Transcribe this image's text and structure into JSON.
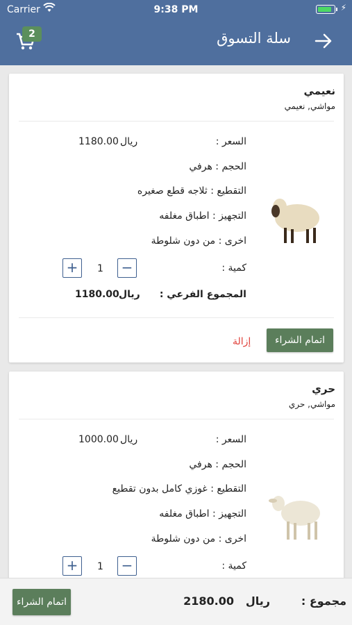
{
  "status_bar": {
    "carrier": "Carrier",
    "time": "9:38 PM",
    "battery_level": 0.85
  },
  "header": {
    "title": "سلة التسوق",
    "cart_count": "2"
  },
  "items": [
    {
      "name": "نعيمي",
      "category": "مواشي, نعيمي",
      "price_label": "السعر :",
      "price_value": "1180.00",
      "currency": "ريال",
      "size": "الحجم : هرفي",
      "cutting": "التقطيع : ثلاجه قطع صغيره",
      "preparation": "التجهيز : اطباق مغلفه",
      "other": "اخرى : من دون شلوطة",
      "quantity_label": "كمية :",
      "quantity": "1",
      "subtotal_label": "المجموع الفرعي :",
      "subtotal_value": "1180.00",
      "remove": "إزالة",
      "checkout": "اتمام الشراء"
    },
    {
      "name": "حري",
      "category": "مواشي, حري",
      "price_label": "السعر :",
      "price_value": "1000.00",
      "currency": "ريال",
      "size": "الحجم : هرفي",
      "cutting": "التقطيع : غوزي كامل بدون تقطيع",
      "preparation": "التجهيز : اطباق مغلفه",
      "other": "اخرى : من دون شلوطة",
      "quantity_label": "كمية :",
      "quantity": "1"
    }
  ],
  "footer": {
    "total_label": "مجموع :",
    "currency": "ريال",
    "total_value": "2180.00",
    "checkout": "اتمام الشراء"
  },
  "colors": {
    "header": "#4f6f9e",
    "accent_green": "#5b7e5b",
    "remove_red": "#e0413a",
    "badge": "#5b8f5c"
  }
}
